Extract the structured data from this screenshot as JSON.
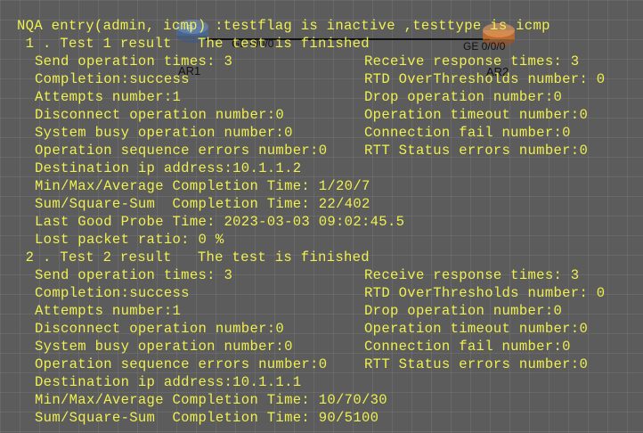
{
  "topology": {
    "device_left": "AR1",
    "device_right": "AR2",
    "port_left": "GE 0/0/0",
    "port_right": "GE 0/0/0",
    "colors": {
      "router_left": "#4a6fa5",
      "router_right": "#d9782d",
      "link": "#111111"
    }
  },
  "terminal": {
    "text_color": "#f0f050",
    "header": "NQA entry(admin, icmp) :testflag is inactive ,testtype is icmp",
    "tests": [
      {
        "title": " 1 . Test 1 result   The test is finished",
        "send_times": "Send operation times: 3",
        "receive_times": "Receive response times: 3",
        "completion": "Completion:success",
        "rtd_overthresholds": "RTD OverThresholds number: 0",
        "attempts": "Attempts number:1",
        "drop": "Drop operation number:0",
        "disconnect": "Disconnect operation number:0",
        "timeout": "Operation timeout number:0",
        "busy": "System busy operation number:0",
        "conn_fail": "Connection fail number:0",
        "seq_errors": "Operation sequence errors number:0",
        "rtt_status": "RTT Status errors number:0",
        "dest_ip": "Destination ip address:10.1.1.2",
        "min_max_avg": "Min/Max/Average Completion Time: 1/20/7",
        "sum_square": "Sum/Square-Sum  Completion Time: 22/402",
        "last_good": "Last Good Probe Time: 2023-03-03 09:02:45.5",
        "lost_ratio": "Lost packet ratio: 0 %"
      },
      {
        "title": " 2 . Test 2 result   The test is finished",
        "send_times": "Send operation times: 3",
        "receive_times": "Receive response times: 3",
        "completion": "Completion:success",
        "rtd_overthresholds": "RTD OverThresholds number: 0",
        "attempts": "Attempts number:1",
        "drop": "Drop operation number:0",
        "disconnect": "Disconnect operation number:0",
        "timeout": "Operation timeout number:0",
        "busy": "System busy operation number:0",
        "conn_fail": "Connection fail number:0",
        "seq_errors": "Operation sequence errors number:0",
        "rtt_status": "RTT Status errors number:0",
        "dest_ip": "Destination ip address:10.1.1.1",
        "min_max_avg": "Min/Max/Average Completion Time: 10/70/30",
        "sum_square": "Sum/Square-Sum  Completion Time: 90/5100"
      }
    ]
  }
}
